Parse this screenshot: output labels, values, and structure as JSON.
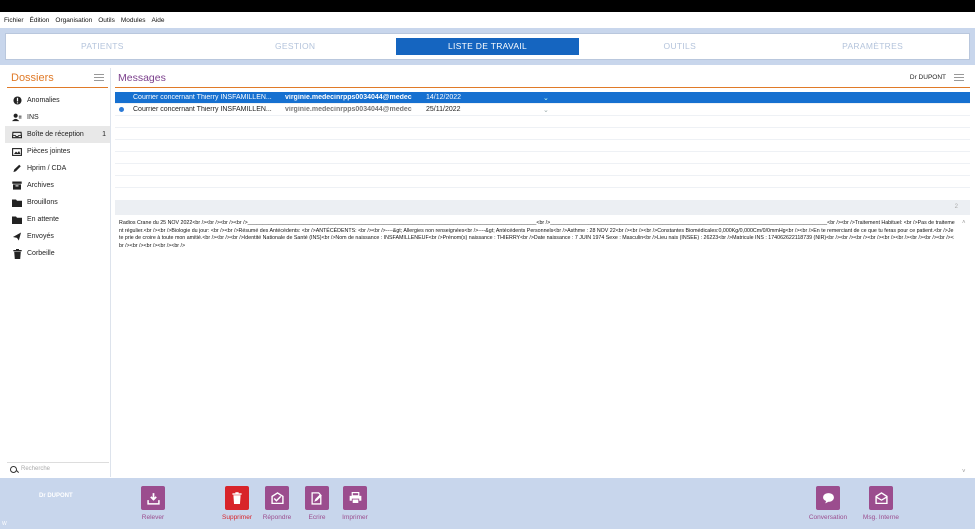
{
  "menu": [
    "Fichier",
    "Édition",
    "Organisation",
    "Outils",
    "Modules",
    "Aide"
  ],
  "nav": {
    "tabs": [
      "PATIENTS",
      "GESTION",
      "LISTE DE TRAVAIL",
      "OUTILS",
      "PARAMÈTRES"
    ],
    "active_index": 2
  },
  "sidebar": {
    "title": "Dossiers",
    "items": [
      {
        "label": "Anomalies",
        "icon": "alert-icon",
        "count": ""
      },
      {
        "label": "INS",
        "icon": "user-id-icon",
        "count": ""
      },
      {
        "label": "Boîte de réception",
        "icon": "inbox-icon",
        "count": "1"
      },
      {
        "label": "Pièces jointes",
        "icon": "attachment-icon",
        "count": ""
      },
      {
        "label": "Hprim / CDA",
        "icon": "pen-icon",
        "count": ""
      },
      {
        "label": "Archives",
        "icon": "archive-icon",
        "count": ""
      },
      {
        "label": "Brouillons",
        "icon": "folder-icon",
        "count": ""
      },
      {
        "label": "En attente",
        "icon": "folder-icon",
        "count": ""
      },
      {
        "label": "Envoyés",
        "icon": "send-icon",
        "count": ""
      },
      {
        "label": "Corbeille",
        "icon": "trash-icon",
        "count": ""
      }
    ],
    "active_index": 2,
    "search_placeholder": "Recherche"
  },
  "messages": {
    "title": "Messages",
    "doctor": "Dr DUPONT",
    "rows": [
      {
        "subject": "Courrier concernant Thierry INSFAMILLEN...",
        "from": "virginie.medecinrpps0034044@medec",
        "date": "14/12/2022",
        "selected": true,
        "unread": false
      },
      {
        "subject": "Courrier concernant Thierry INSFAMILLEN...",
        "from": "virginie.medecinrpps0034044@medec",
        "date": "25/11/2022",
        "selected": false,
        "unread": true
      }
    ],
    "pager": "2"
  },
  "body": "Radios Crane du 25 NOV 2022<br /><br /><br /><br />__________________________________________________________________________________________________<br />______________________________________________________________________________________________<br /><br />Traitement Habituel: <br />Pas de traitement régulier.<br /><br />Biologie du jour: <br /><br />Résumé des Antécédents: <br />ANTÉCÉDENTS: <br /><br />----&gt; Allergies non renseignées<br />----&gt; Antécédents Personnels<br />Asthme : 28 NOV 22<br /><br /><br />Constantes Biomédicales:0,000Kg/0,000Cm/0/0mmHg<br /><br />En te remerciant de ce que tu feras pour ce patient.<br />Je te prie de croire à toute mon amitié.<br /><br /><br />Identité Nationale de Santé (INS)<br />Nom de naissance : INSFAMILLENEUF<br />Prénom(s) naissance : THIERRY<br />Date naissance : 7 JUIN 1974 Sexe : Masculin<br />Lieu nais (INSEE) : 26223<br />Matricule INS : 174062622118739 (NIR)<br /><br /><br /><br /><br /><br /><br /><br /><br /><br /><br /><br /><br /><br />",
  "toolbar": {
    "user": "Dr DUPONT",
    "buttons": [
      {
        "label": "Relever",
        "icon": "download-icon"
      },
      {
        "label": "Supprimer",
        "icon": "trash-icon"
      },
      {
        "label": "Répondre",
        "icon": "reply-icon"
      },
      {
        "label": "Ecrire",
        "icon": "write-icon"
      },
      {
        "label": "Imprimer",
        "icon": "print-icon"
      },
      {
        "label": "Conversation",
        "icon": "chat-icon"
      },
      {
        "label": "Msg. Interne",
        "icon": "internal-mail-icon"
      }
    ],
    "version": "W"
  },
  "colors": {
    "accent": "#1670d0",
    "orange": "#e07a28",
    "purple": "#9b4d8e",
    "red": "#d8242a",
    "bar": "#c8d6ec"
  }
}
